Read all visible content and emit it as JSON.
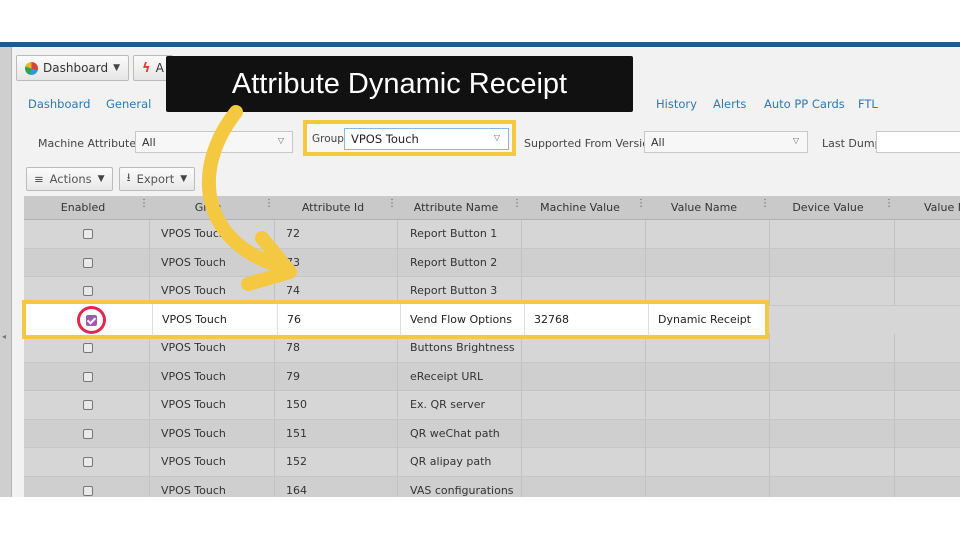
{
  "toolbar": {
    "dashboard_label": "Dashboard",
    "second_label": "A"
  },
  "tabs": [
    {
      "label": "Dashboard"
    },
    {
      "label": "General"
    },
    {
      "label": "History"
    },
    {
      "label": "Alerts"
    },
    {
      "label": "Auto PP Cards"
    },
    {
      "label": "FTL"
    }
  ],
  "filters": {
    "machine_attributes_label": "Machine Attributes",
    "machine_attributes_value": "All",
    "group_label": "Group",
    "group_value": "VPOS Touch",
    "supported_from_label": "Supported From Version",
    "supported_from_value": "All",
    "last_dump_label": "Last Dump:"
  },
  "actions": {
    "actions_label": "Actions",
    "export_label": "Export"
  },
  "grid": {
    "columns": [
      "Enabled",
      "Grou",
      "Attribute Id",
      "Attribute Name",
      "Machine Value",
      "Value Name",
      "Device Value",
      "Value N"
    ],
    "rows": [
      {
        "enabled": false,
        "group": "VPOS Touch",
        "id": "72",
        "name": "Report Button 1",
        "machine_value": "",
        "value_name": ""
      },
      {
        "enabled": false,
        "group": "VPOS Touch",
        "id": "73",
        "name": "Report Button 2",
        "machine_value": "",
        "value_name": ""
      },
      {
        "enabled": false,
        "group": "VPOS Touch",
        "id": "74",
        "name": "Report Button 3",
        "machine_value": "",
        "value_name": ""
      },
      {
        "enabled": true,
        "group": "VPOS Touch",
        "id": "76",
        "name": "Vend Flow Options",
        "machine_value": "32768",
        "value_name": "Dynamic Receipt"
      },
      {
        "enabled": false,
        "group": "VPOS Touch",
        "id": "78",
        "name": "Buttons Brightness",
        "machine_value": "",
        "value_name": ""
      },
      {
        "enabled": false,
        "group": "VPOS Touch",
        "id": "79",
        "name": "eReceipt URL",
        "machine_value": "",
        "value_name": ""
      },
      {
        "enabled": false,
        "group": "VPOS Touch",
        "id": "150",
        "name": "Ex. QR server",
        "machine_value": "",
        "value_name": ""
      },
      {
        "enabled": false,
        "group": "VPOS Touch",
        "id": "151",
        "name": "QR weChat path",
        "machine_value": "",
        "value_name": ""
      },
      {
        "enabled": false,
        "group": "VPOS Touch",
        "id": "152",
        "name": "QR alipay path",
        "machine_value": "",
        "value_name": ""
      },
      {
        "enabled": false,
        "group": "VPOS Touch",
        "id": "164",
        "name": "VAS configurations",
        "machine_value": "",
        "value_name": ""
      }
    ]
  },
  "banner": {
    "text": "Attribute Dynamic Receipt"
  },
  "colors": {
    "highlight": "#f5c842",
    "ring": "#e5244f",
    "checkbox_checked": "#a455b8",
    "link": "#2c79b5",
    "banner_bg": "#111111"
  }
}
